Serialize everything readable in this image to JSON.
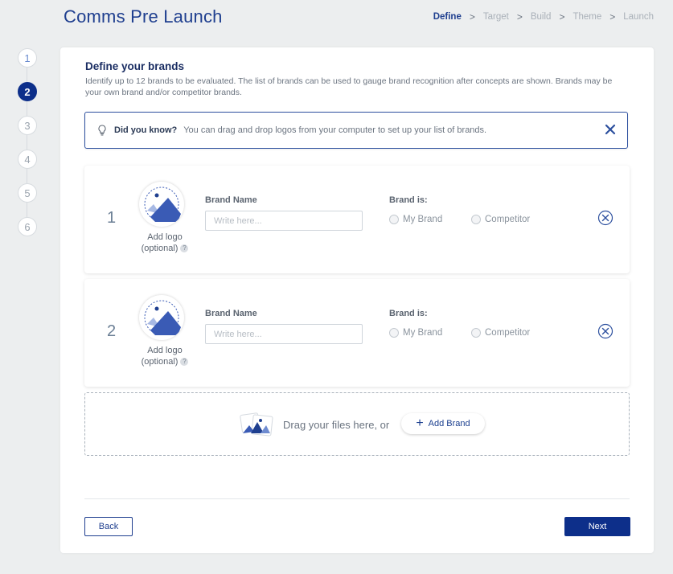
{
  "header": {
    "title": "Comms Pre Launch"
  },
  "breadcrumb": [
    {
      "label": "Define",
      "active": true
    },
    {
      "label": "Target",
      "active": false
    },
    {
      "label": "Build",
      "active": false
    },
    {
      "label": "Theme",
      "active": false
    },
    {
      "label": "Launch",
      "active": false
    }
  ],
  "breadcrumb_separator": ">",
  "stepper": {
    "steps": [
      "1",
      "2",
      "3",
      "4",
      "5",
      "6"
    ],
    "current": "2"
  },
  "section": {
    "title": "Define your brands",
    "description": "Identify up to 12 brands to be evaluated. The list of brands can be used to gauge brand recognition after concepts are shown. Brands may be your own brand and/or competitor brands."
  },
  "tip": {
    "icon": "lightbulb-icon",
    "heading": "Did you know?",
    "text": "You can drag and drop logos from your computer to set up your list of brands.",
    "close_icon": "close-icon"
  },
  "brands": [
    {
      "number": "1",
      "logo_label": "Add logo",
      "logo_optional": "(optional)",
      "help": "?",
      "name_label": "Brand Name",
      "name_value": "",
      "name_placeholder": "Write here...",
      "type_label": "Brand is:",
      "options": [
        "My Brand",
        "Competitor"
      ]
    },
    {
      "number": "2",
      "logo_label": "Add logo",
      "logo_optional": "(optional)",
      "help": "?",
      "name_label": "Brand Name",
      "name_value": "",
      "name_placeholder": "Write here...",
      "type_label": "Brand is:",
      "options": [
        "My Brand",
        "Competitor"
      ]
    }
  ],
  "dropzone": {
    "text": "Drag your files here, or",
    "button_label": "Add Brand",
    "button_icon": "plus-icon"
  },
  "footer": {
    "back_label": "Back",
    "next_label": "Next"
  },
  "colors": {
    "primary": "#0d2f8a",
    "accent": "#3a5bb5",
    "background": "#eceeef"
  }
}
